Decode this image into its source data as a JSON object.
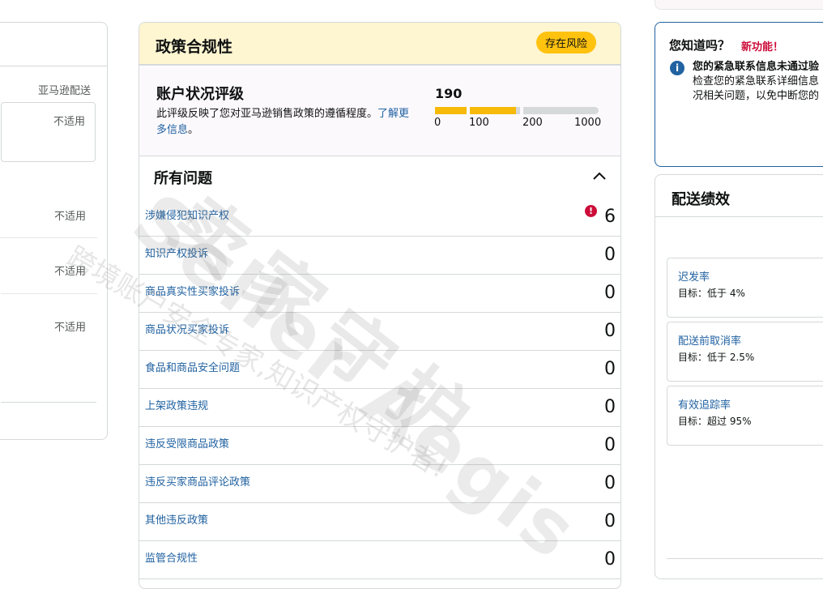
{
  "left": {
    "fulfillment_label": "亚马逊配送",
    "not_applicable": "不适用"
  },
  "policy": {
    "title": "政策合规性",
    "risk_badge": "存在风险",
    "health": {
      "title": "账户状况评级",
      "desc": "此评级反映了您对亚马逊销售政策的遵循程度。",
      "link": "了解更多信息",
      "link_suffix": "。",
      "score": "190",
      "scale": [
        "0",
        "100",
        "200",
        "1000"
      ],
      "score_fraction": 0.19
    },
    "issues": {
      "title": "所有问题",
      "rows": [
        {
          "label": "涉嫌侵犯知识产权",
          "count": "6",
          "alert": true
        },
        {
          "label": "知识产权投诉",
          "count": "0"
        },
        {
          "label": "商品真实性买家投诉",
          "count": "0"
        },
        {
          "label": "商品状况买家投诉",
          "count": "0"
        },
        {
          "label": "食品和商品安全问题",
          "count": "0"
        },
        {
          "label": "上架政策违规",
          "count": "0"
        },
        {
          "label": "违反受限商品政策",
          "count": "0"
        },
        {
          "label": "违反买家商品评论政策",
          "count": "0"
        },
        {
          "label": "其他违反政策",
          "count": "0"
        },
        {
          "label": "监管合规性",
          "count": "0"
        }
      ]
    }
  },
  "tip": {
    "title": "您知道吗？",
    "new_feature": "新功能！",
    "line1": "您的紧急联系信息未通过验",
    "line2": "检查您的紧急联系详细信息",
    "line3": "况相关问题，以免中断您的"
  },
  "delivery": {
    "title": "配送绩效",
    "metrics": [
      {
        "label": "迟发率",
        "target": "目标：低于 4%"
      },
      {
        "label": "配送前取消率",
        "target": "目标：低于 2.5%"
      },
      {
        "label": "有效追踪率",
        "target": "目标：超过 95%"
      }
    ]
  },
  "watermark": {
    "en": "Seller Aegis",
    "cn_big": "卖家守护",
    "cn_small": "跨境账户安全专家,知识产权守护者!"
  },
  "colors": {
    "link": "#2162a1",
    "risk_badge": "#ffc20e",
    "bar_fill": "#f7ba0b",
    "alert": "#cc0c39",
    "header_bg": "#fef5d1"
  }
}
